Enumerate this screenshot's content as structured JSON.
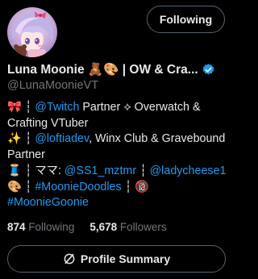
{
  "header": {
    "follow_button_label": "Following",
    "avatar_icon": "profile-picture-anime-avatar"
  },
  "profile": {
    "display_name": "Luna Moonie 🧸🎨 | OW & Cra...",
    "handle": "@LunaMoonieVT",
    "verified_icon": "verified-badge-icon",
    "accent_color": "#1d9bf0"
  },
  "bio": {
    "line1": {
      "prefix": "🎀 ┆ ",
      "link": "@Twitch",
      "suffix": " Partner ⟡ Overwatch &"
    },
    "line2": {
      "text": "Crafting VTuber"
    },
    "line3": {
      "prefix": "✨ ┆ ",
      "link": "@loftiadev",
      "suffix": ", Winx Club & Gravebound"
    },
    "line4": {
      "text": "Partner"
    },
    "line5": {
      "prefix": "🧵 ┆ ママ: ",
      "link1": "@SS1_mztmr",
      "sep": " ┆ ",
      "link2": "@ladycheese1"
    },
    "line6": {
      "prefix": "🎨 ┆ ",
      "link": "#MoonieDoodles",
      "suffix": " ┆ 🔞"
    },
    "line7": {
      "link": "#MoonieGoonie"
    }
  },
  "stats": {
    "following_count": "874",
    "following_label": "Following",
    "followers_count": "5,678",
    "followers_label": "Followers"
  },
  "summary_button": {
    "label": "Profile Summary",
    "icon": "grok-summary-icon"
  }
}
